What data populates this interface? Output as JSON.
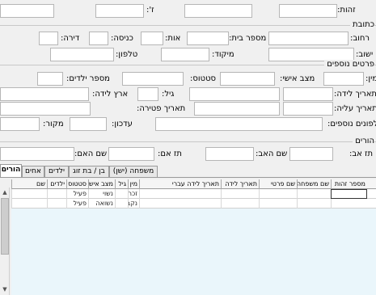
{
  "top": {
    "id_label": "זהות:",
    "id_value": "",
    "z_label": "ז':",
    "z_value": "",
    "field_a": "",
    "field_b": ""
  },
  "address": {
    "group_title": "כתובת",
    "street_label": "רחוב:",
    "street_value": "",
    "house_label": "מספר בית:",
    "house_value": "",
    "letter_label": "אות:",
    "letter_value": "",
    "entrance_label": "כניסה:",
    "entrance_value": "",
    "apartment_label": "דירה:",
    "apartment_value": "",
    "settlement_label": "ישוב:",
    "settlement_value": "",
    "zip_label": "מיקוד:",
    "zip_value": "",
    "phone_label": "טלפון:",
    "phone_value": ""
  },
  "more": {
    "group_title": "פרטים נוספים",
    "gender_label": "מין:",
    "gender_value": "",
    "marital_label": "מצב אישי:",
    "marital_value": "",
    "status_label": "סטטוס:",
    "status_value": "",
    "children_label": "מספר ילדים:",
    "children_value": "",
    "birthdate_label": "תאריך לידה:",
    "birthdate_value": "",
    "age_label": "גיל:",
    "age_value": "",
    "birth_country_label": "ארץ לידה:",
    "birth_country_value": "",
    "aliya_label": "תאריך עליה:",
    "aliya_value": "",
    "death_label": "תאריך פטירה:",
    "death_value": "",
    "extra_phones_label": "טלפונים נוספים:",
    "extra_phones_value": "",
    "update_label": "עדכון:",
    "update_value": "",
    "source_label": "מקור:",
    "source_value": ""
  },
  "parents": {
    "group_title": "הורים",
    "father_id_label": "תז אב:",
    "father_id_value": "",
    "father_name_label": "שם האב:",
    "father_name_value": "",
    "mother_id_label": "תז אם:",
    "mother_id_value": "",
    "mother_name_label": "שם האם:",
    "mother_name_value": ""
  },
  "tabs": [
    {
      "label": "הורים",
      "active": true
    },
    {
      "label": "אחים",
      "active": false
    },
    {
      "label": "ילדים",
      "active": false
    },
    {
      "label": "בן / בת זוג",
      "active": false
    },
    {
      "label": "משפחה (ישן)",
      "active": false
    }
  ],
  "grid": {
    "columns": [
      "מספר זהות",
      "שם משפחה",
      "שם פרטי",
      "תאריך לידה",
      "תאריך לידה עברי",
      "מין",
      "גיל",
      "מצב אישי",
      "סטטוס",
      "ילדים",
      "שם"
    ],
    "rows": [
      [
        "",
        "",
        "",
        "",
        "",
        "זכר",
        "",
        "נשוי",
        "פעיל",
        "",
        ""
      ],
      [
        "",
        "",
        "",
        "",
        "",
        "נקבה",
        "",
        "נשואה",
        "פעיל",
        "",
        ""
      ]
    ]
  }
}
